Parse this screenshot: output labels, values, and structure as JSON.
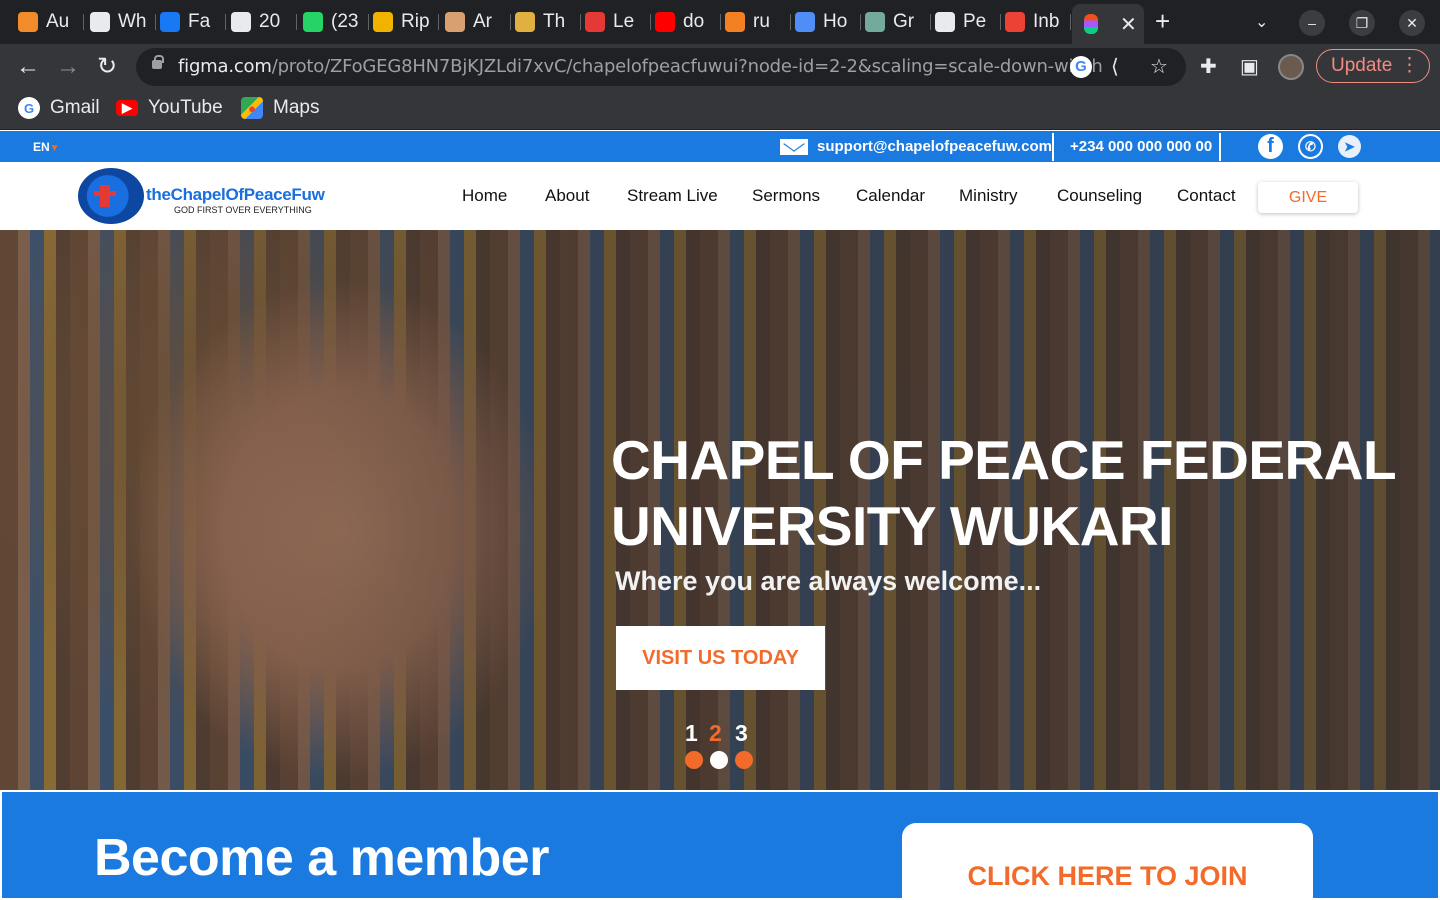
{
  "browser": {
    "tabs": [
      {
        "label": "Au",
        "icon": "stack-icon",
        "color": "#f28b2a"
      },
      {
        "label": "Wh",
        "icon": "globe-icon",
        "color": "#e8eaed"
      },
      {
        "label": "Fa",
        "icon": "facebook-icon",
        "color": "#1877f2"
      },
      {
        "label": "20",
        "icon": "globe-icon",
        "color": "#e8eaed"
      },
      {
        "label": "(23",
        "icon": "whatsapp-icon",
        "color": "#25d366"
      },
      {
        "label": "Rip",
        "icon": "replit-icon",
        "color": "#f0b400"
      },
      {
        "label": "Ar",
        "icon": "fox-icon",
        "color": "#d8a070"
      },
      {
        "label": "Th",
        "icon": "bookmark-icon",
        "color": "#e0b040"
      },
      {
        "label": "Le",
        "icon": "stripes-icon",
        "color": "#e53935"
      },
      {
        "label": "do",
        "icon": "youtube-icon",
        "color": "#ff0000"
      },
      {
        "label": "ru",
        "icon": "stackoverflow-icon",
        "color": "#f48024"
      },
      {
        "label": "Ho",
        "icon": "ring-icon",
        "color": "#4f8ef7"
      },
      {
        "label": "Gr",
        "icon": "chatgpt-icon",
        "color": "#74aa9c"
      },
      {
        "label": "Pe",
        "icon": "globe-icon",
        "color": "#e8eaed"
      },
      {
        "label": "Inb",
        "icon": "gmail-icon",
        "color": "#ea4335"
      }
    ],
    "active_tab_icon": "figma-icon",
    "url_host": "figma.com",
    "url_path": "/proto/ZFoGEG8HN7BjKJZLdi7xvC/chapelofpeacfuwui?node-id=2-2&scaling=scale-down-width",
    "update_label": "Update",
    "bookmarks": [
      {
        "label": "Gmail",
        "icon": "google-icon"
      },
      {
        "label": "YouTube",
        "icon": "youtube-icon"
      },
      {
        "label": "Maps",
        "icon": "maps-icon"
      }
    ]
  },
  "site": {
    "topbar": {
      "lang": "EN",
      "email": "support@chapelofpeacefuw.com",
      "phone": "+234 000 000 000 00",
      "social": [
        "facebook-icon",
        "whatsapp-icon",
        "telegram-icon"
      ]
    },
    "logo": {
      "name": "theChapelOfPeaceFuw",
      "tagline": "GOD FIRST OVER EVERYTHING"
    },
    "menu": [
      "Home",
      "About",
      "Stream Live",
      "Sermons",
      "Calendar",
      "Ministry",
      "Counseling",
      "Contact"
    ],
    "give_label": "GIVE",
    "hero": {
      "title": "CHAPEL OF PEACE FEDERAL UNIVERSITY WUKARI",
      "subtitle": "Where you are always welcome...",
      "cta": "VISIT US TODAY",
      "slides": [
        "1",
        "2",
        "3"
      ],
      "active_slide": 2
    },
    "member": {
      "title": "Become a member",
      "cta": "CLICK HERE TO JOIN"
    }
  },
  "colors": {
    "brand_blue": "#1a7ae0",
    "accent_orange": "#f26b2a"
  }
}
